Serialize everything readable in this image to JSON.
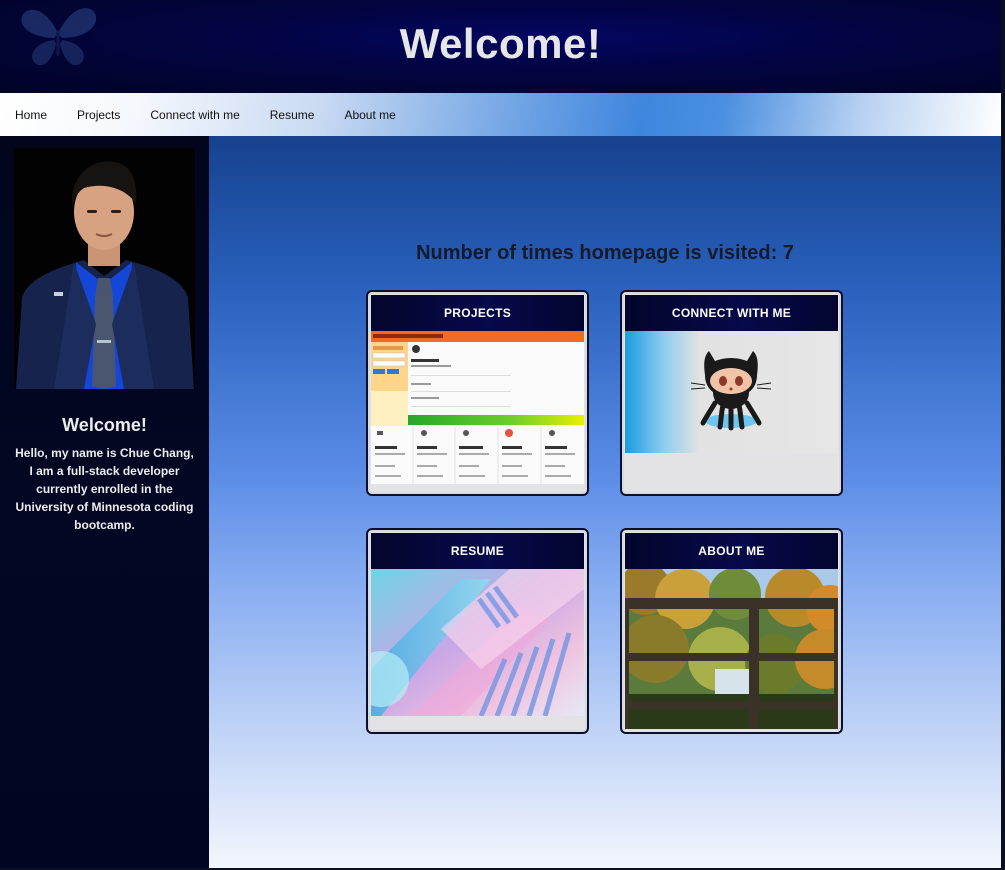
{
  "header": {
    "title": "Welcome!",
    "logo_icon": "butterfly-icon"
  },
  "nav": {
    "items": [
      {
        "label": "Home"
      },
      {
        "label": "Projects"
      },
      {
        "label": "Connect with me"
      },
      {
        "label": "Resume"
      },
      {
        "label": "About me"
      }
    ]
  },
  "sidebar": {
    "title": "Welcome!",
    "bio": "Hello, my name is Chue Chang, I am a full-stack developer currently enrolled in the University of Minnesota coding bootcamp."
  },
  "main": {
    "visit_counter": "Number of times homepage is visited: 7",
    "cards": [
      {
        "title": "PROJECTS",
        "image": "weather-dashboard-screenshot"
      },
      {
        "title": "CONNECT WITH ME",
        "image": "github-octocat-logo"
      },
      {
        "title": "RESUME",
        "image": "abstract-pastel-graphic"
      },
      {
        "title": "ABOUT ME",
        "image": "autumn-forest-photo"
      }
    ]
  },
  "colors": {
    "header_bg": "#020440",
    "main_gradient_top": "#16428f",
    "main_gradient_bottom": "#f3f6fd",
    "card_head_bg": "#06094a"
  }
}
